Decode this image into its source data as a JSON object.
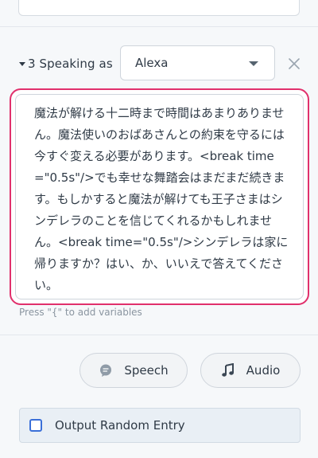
{
  "speaking": {
    "step_label": "3 Speaking as",
    "voice_value": "Alexa"
  },
  "text_block": {
    "content": "魔法が解ける十二時まで時間はあまりありません。魔法使いのおばあさんとの約束を守るには今すぐ変える必要があります。<break time=\"0.5s\"/>でも幸せな舞踏会はまだまだ続きます。もしかすると魔法が解けても王子さまはシンデレラのことを信じてくれるかもしれません。<break time=\"0.5s\"/>シンデレラは家に帰りますか？はい、か、いいえで答えてください。",
    "hint": "Press \"{\" to add variables"
  },
  "buttons": {
    "speech_label": "Speech",
    "audio_label": "Audio"
  },
  "random_entry": {
    "label": "Output Random Entry"
  },
  "colors": {
    "focus_ring": "#e1306c",
    "checkbox_border": "#3a6fd8"
  },
  "icons": {
    "speech": "chat-bubble-icon",
    "audio": "music-note-icon",
    "remove": "close-icon",
    "dropdown": "chevron-down-icon",
    "collapse": "caret-down-icon"
  }
}
